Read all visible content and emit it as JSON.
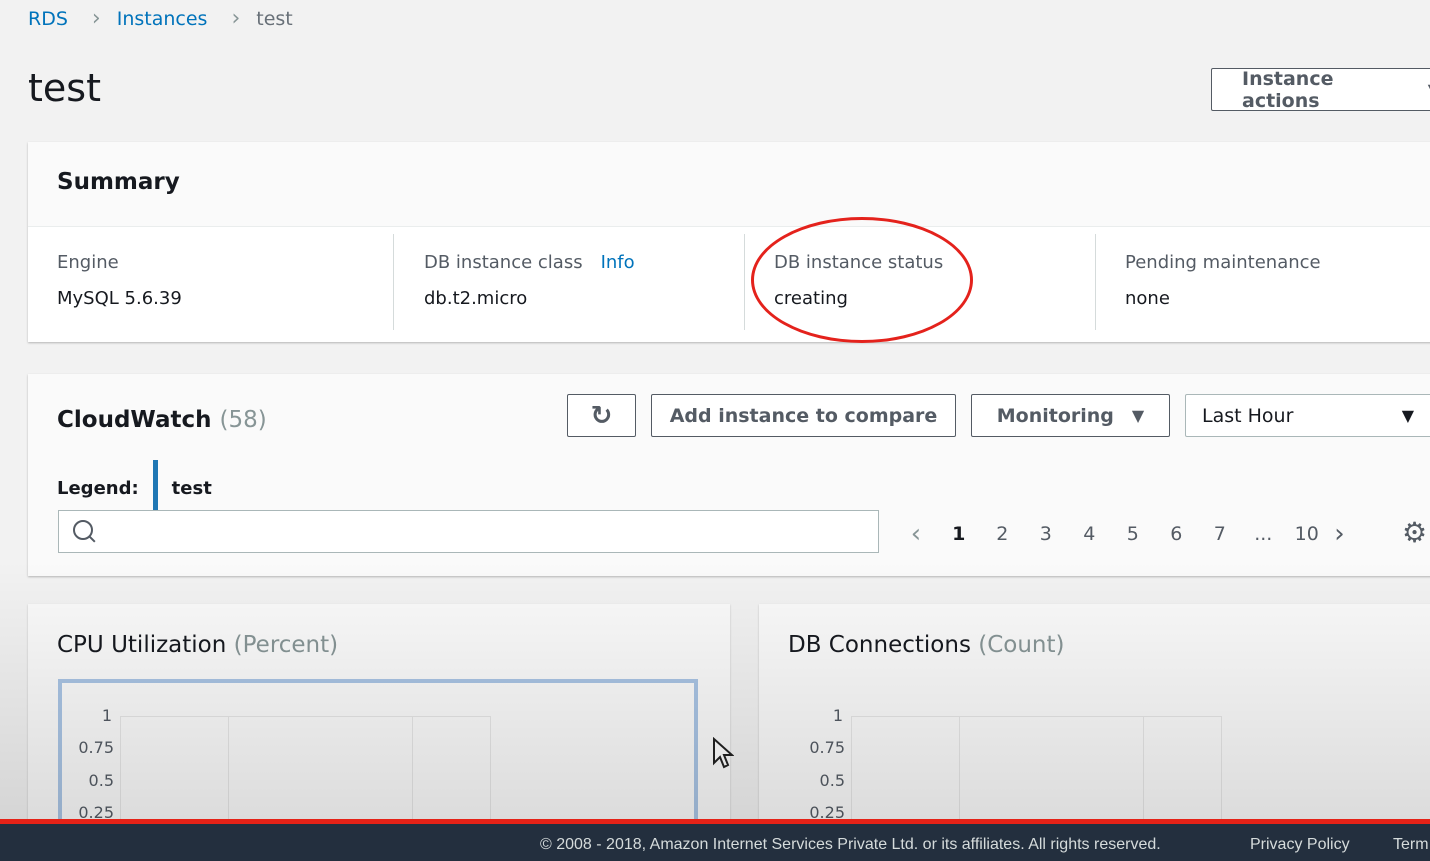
{
  "breadcrumb": {
    "root": "RDS",
    "section": "Instances",
    "current": "test"
  },
  "page": {
    "title": "test",
    "actions_label": "Instance actions"
  },
  "summary": {
    "heading": "Summary",
    "engine": {
      "label": "Engine",
      "value": "MySQL 5.6.39"
    },
    "class": {
      "label": "DB instance class",
      "info": "Info",
      "value": "db.t2.micro"
    },
    "status": {
      "label": "DB instance status",
      "value": "creating"
    },
    "maintenance": {
      "label": "Pending maintenance",
      "value": "none"
    }
  },
  "cloudwatch": {
    "title": "CloudWatch",
    "count": "(58)",
    "legend_label": "Legend:",
    "legend_item": "test",
    "add_compare": "Add instance to compare",
    "monitoring": "Monitoring",
    "time_range": "Last Hour",
    "pages": [
      "1",
      "2",
      "3",
      "4",
      "5",
      "6",
      "7",
      "...",
      "10"
    ],
    "active_page": "1"
  },
  "charts": [
    {
      "title": "CPU Utilization",
      "unit": "(Percent)",
      "y_ticks": [
        "1",
        "0.75",
        "0.5",
        "0.25"
      ]
    },
    {
      "title": "DB Connections",
      "unit": "(Count)",
      "y_ticks": [
        "1",
        "0.75",
        "0.5",
        "0.25"
      ]
    }
  ],
  "footer": {
    "copyright": "© 2008 - 2018, Amazon Internet Services Private Ltd. or its affiliates. All rights reserved.",
    "privacy": "Privacy Policy",
    "terms": "Term"
  },
  "colors": {
    "link": "#0073bb",
    "highlight": "#e4221c",
    "legend": "#1f77b4",
    "footer_bg": "#232f3e"
  }
}
